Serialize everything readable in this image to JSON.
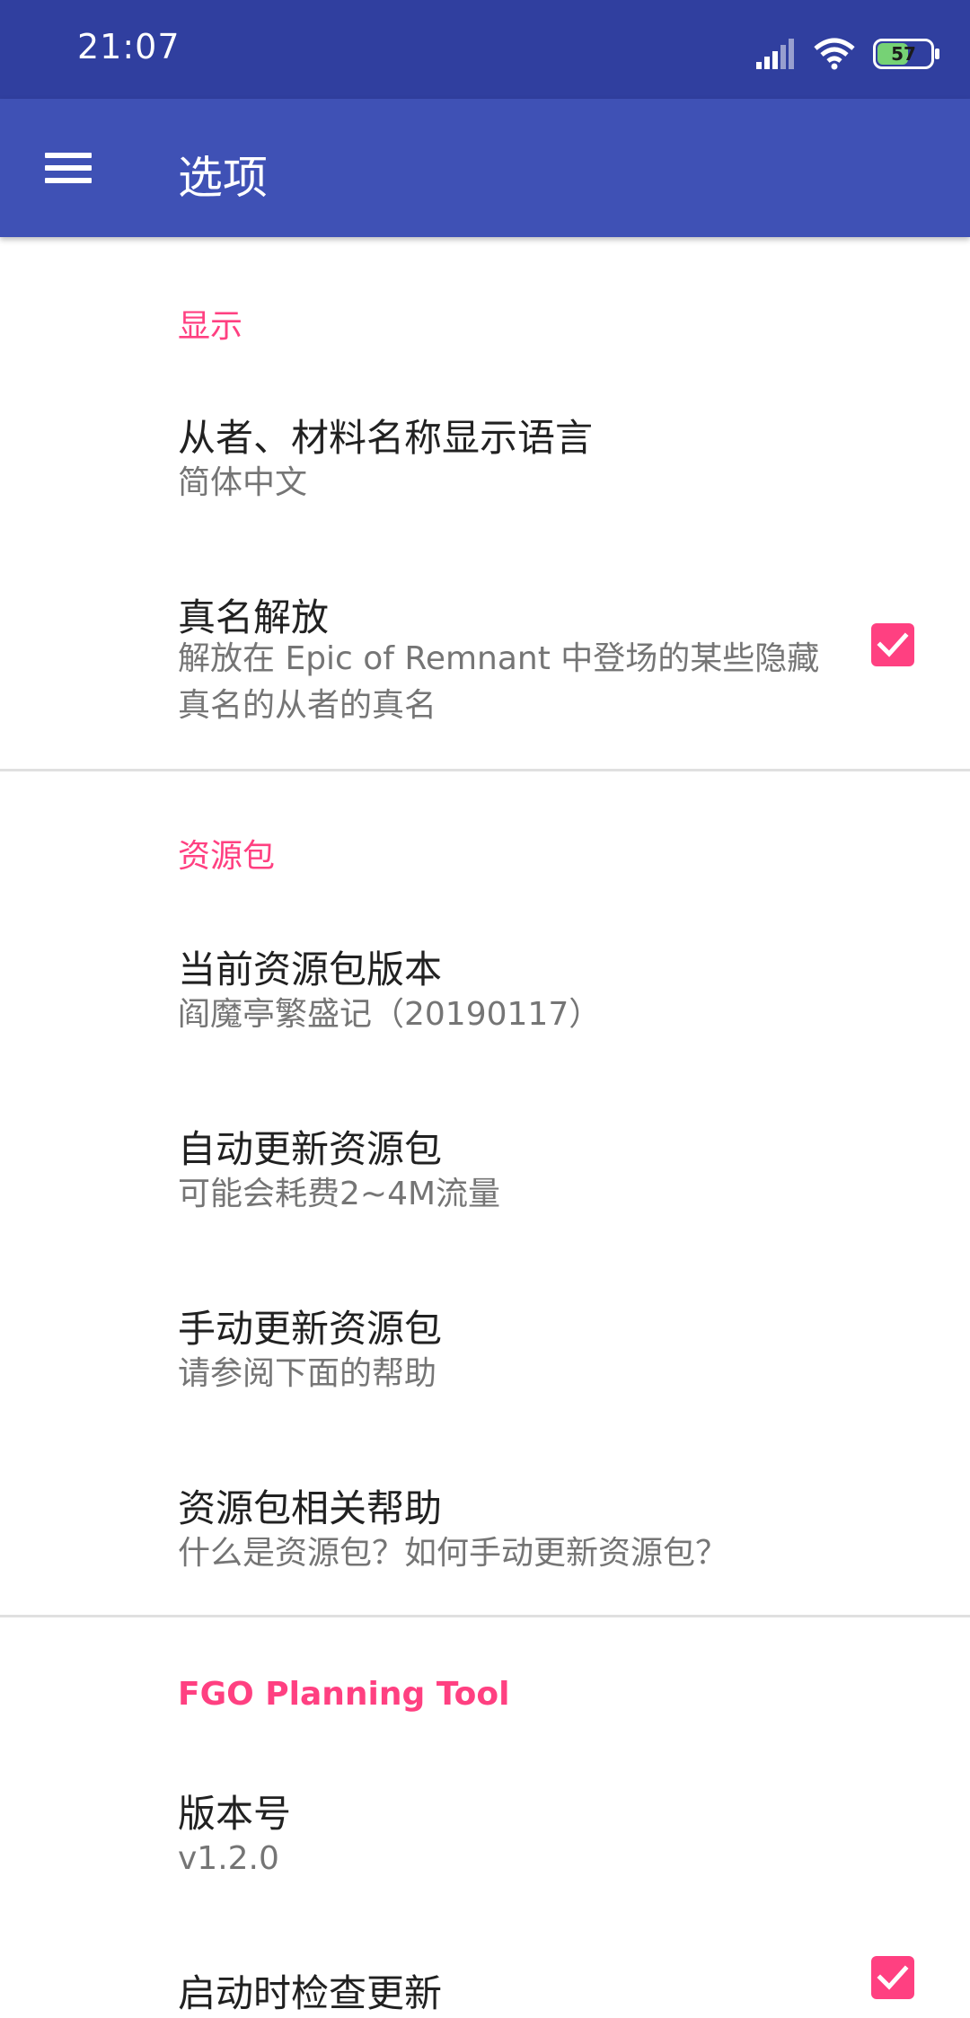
{
  "status_bar": {
    "time": "21:07",
    "battery": "57"
  },
  "app_bar": {
    "title": "选项",
    "menu_icon": "hamburger-menu-icon"
  },
  "sections": {
    "display": {
      "title": "显示",
      "items": {
        "language": {
          "title": "从者、材料名称显示语言",
          "summary": "简体中文"
        },
        "true_name": {
          "title": "真名解放",
          "summary": "解放在 Epic of Remnant 中登场的某些隐藏真名的从者的真名",
          "checked": true
        }
      }
    },
    "resource": {
      "title": "资源包",
      "items": {
        "current": {
          "title": "当前资源包版本",
          "summary": "阎魔亭繁盛记（20190117）"
        },
        "auto_update": {
          "title": "自动更新资源包",
          "summary": "可能会耗费2~4M流量"
        },
        "manual_update": {
          "title": "手动更新资源包",
          "summary": "请参阅下面的帮助"
        },
        "help": {
          "title": "资源包相关帮助",
          "summary": "什么是资源包？如何手动更新资源包？"
        }
      }
    },
    "app": {
      "title": "FGO Planning Tool",
      "items": {
        "version": {
          "title": "版本号",
          "summary": "v1.2.0"
        },
        "check_update": {
          "title": "启动时检查更新",
          "checked": true
        }
      }
    }
  },
  "colors": {
    "status_bar": "#303f9f",
    "app_bar": "#3f51b5",
    "accent": "#ff4081"
  }
}
